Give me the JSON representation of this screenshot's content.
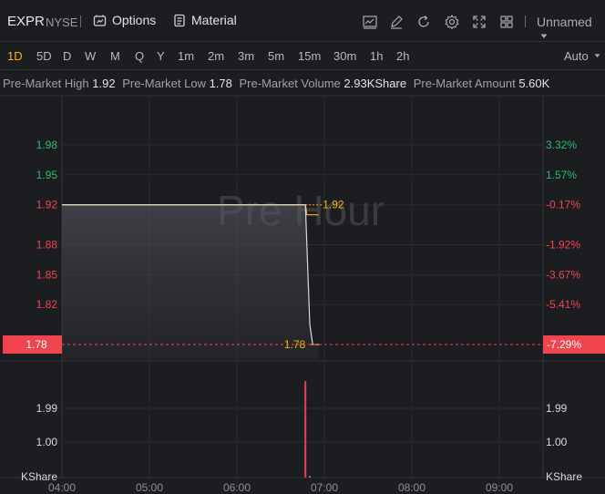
{
  "header": {
    "symbol": "EXPR",
    "exchange": "NYSE",
    "options_label": "Options",
    "material_label": "Material",
    "layout_name": "Unnamed",
    "tool_icons": [
      "chart-icon",
      "draw-icon",
      "refresh-icon",
      "settings-icon",
      "fullscreen-icon",
      "grid-layout-icon"
    ]
  },
  "timeframes": {
    "items": [
      "1D",
      "5D",
      "D",
      "W",
      "M",
      "Q",
      "Y",
      "1m",
      "2m",
      "3m",
      "5m",
      "15m",
      "30m",
      "1h",
      "2h"
    ],
    "active": "1D",
    "scale_mode": "Auto"
  },
  "premarket": {
    "high_label": "Pre-Market High",
    "high_value": "1.92",
    "low_label": "Pre-Market Low",
    "low_value": "1.78",
    "volume_label": "Pre-Market Volume",
    "volume_value": "2.93KShare",
    "amount_label": "Pre-Market Amount",
    "amount_value": "5.60K"
  },
  "watermark": "Pre Hour",
  "colors": {
    "up": "#2ebd6e",
    "down": "#f0454f",
    "accent": "#f5b800",
    "price_line": "#e6a23c"
  },
  "chart_data": {
    "type": "line",
    "price_axis_left": [
      "1.98",
      "1.95",
      "1.92",
      "1.88",
      "1.85",
      "1.82",
      "1.78"
    ],
    "price_axis_right": [
      "3.32%",
      "1.57%",
      "-0.17%",
      "-1.92%",
      "-3.67%",
      "-5.41%",
      "-7.29%"
    ],
    "current_price_label": "1.78",
    "current_pct_label": "-7.29%",
    "high_marker": "1.92",
    "low_marker": "1.78",
    "x_ticks": [
      "04:00",
      "05:00",
      "06:00",
      "07:00",
      "08:00",
      "09:00"
    ],
    "volume_axis_left": [
      "1.99",
      "1.00",
      "KShare"
    ],
    "volume_axis_right": [
      "1.99",
      "1.00",
      "KShare"
    ],
    "price_series": {
      "x": [
        "04:00",
        "06:47",
        "06:48",
        "06:50",
        "06:52",
        "06:56"
      ],
      "y": [
        1.92,
        1.92,
        1.88,
        1.8,
        1.78,
        1.78
      ]
    },
    "avg_series": {
      "x": [
        "04:00",
        "06:47",
        "06:48",
        "06:56"
      ],
      "y": [
        1.92,
        1.92,
        1.91,
        1.91
      ]
    },
    "volume_series": {
      "x": [
        "06:47",
        "06:50"
      ],
      "y": [
        2.93,
        0.05
      ]
    },
    "ylim": [
      1.78,
      1.98
    ],
    "xlim": [
      "04:00",
      "09:30"
    ],
    "grid": true
  }
}
